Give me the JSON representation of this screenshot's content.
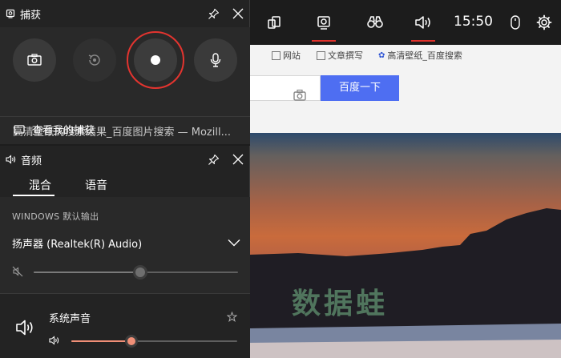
{
  "capture_panel": {
    "title": "捕获",
    "target": "高清壁纸的搜索结果_百度图片搜索 — Mozill...",
    "view_captures_label": "查看我的捕获"
  },
  "audio_panel": {
    "title": "音频",
    "tabs": [
      {
        "label": "混合",
        "active": true
      },
      {
        "label": "语音",
        "active": false
      }
    ],
    "output_label": "WINDOWS 默认输出",
    "device_name": "扬声器 (Realtek(R) Audio)",
    "master_volume_fraction": 0.52,
    "master_muted": true,
    "apps": [
      {
        "name": "系统声音",
        "volume_fraction": 0.36
      }
    ]
  },
  "gamebar": {
    "time": "15:50",
    "active_widgets": [
      "capture",
      "audio"
    ]
  },
  "background_page": {
    "bookmarks": [
      "网站",
      "文章撰写",
      "高清壁纸_百度搜索"
    ],
    "search_button_label": "百度一下",
    "watermark": "数据蛙"
  },
  "colors": {
    "record_ring": "#e3342f",
    "accent_salmon": "#f08f77",
    "active_underline": "#e0312b",
    "baidu_button": "#4e6ef2"
  }
}
